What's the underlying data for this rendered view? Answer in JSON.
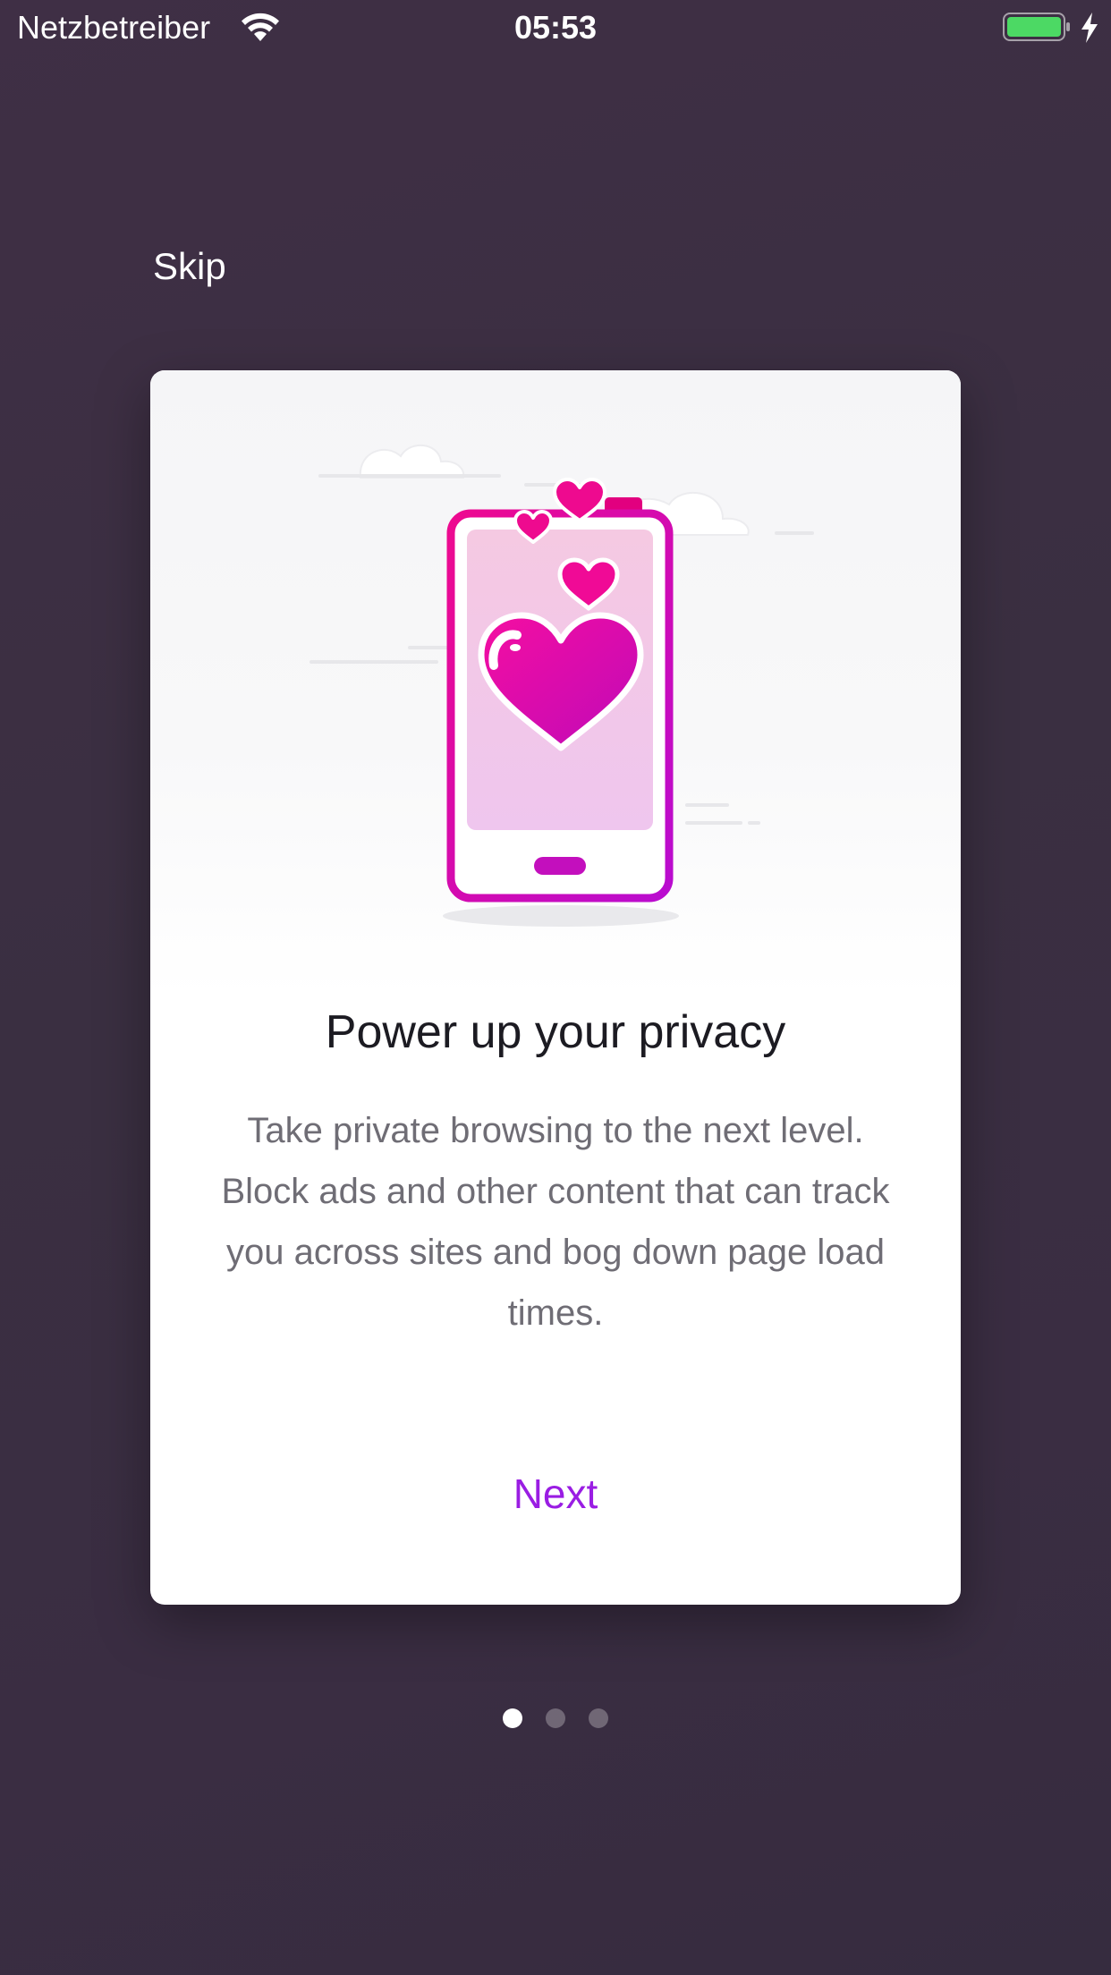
{
  "status_bar": {
    "carrier": "Netzbetreiber",
    "time": "05:53",
    "wifi_icon": "wifi-icon",
    "battery_icon": "battery-charging-icon",
    "battery_color": "#4cd964"
  },
  "onboarding": {
    "skip_label": "Skip",
    "illustration_icon": "phone-with-hearts-illustration",
    "title": "Power up your privacy",
    "body": "Take private browsing to the next level. Block ads and other content that can track you across sites and bog down page load times.",
    "next_label": "Next",
    "accent_color": "#9a1de3"
  },
  "pagination": {
    "total_pages": 3,
    "current_page": 1
  }
}
